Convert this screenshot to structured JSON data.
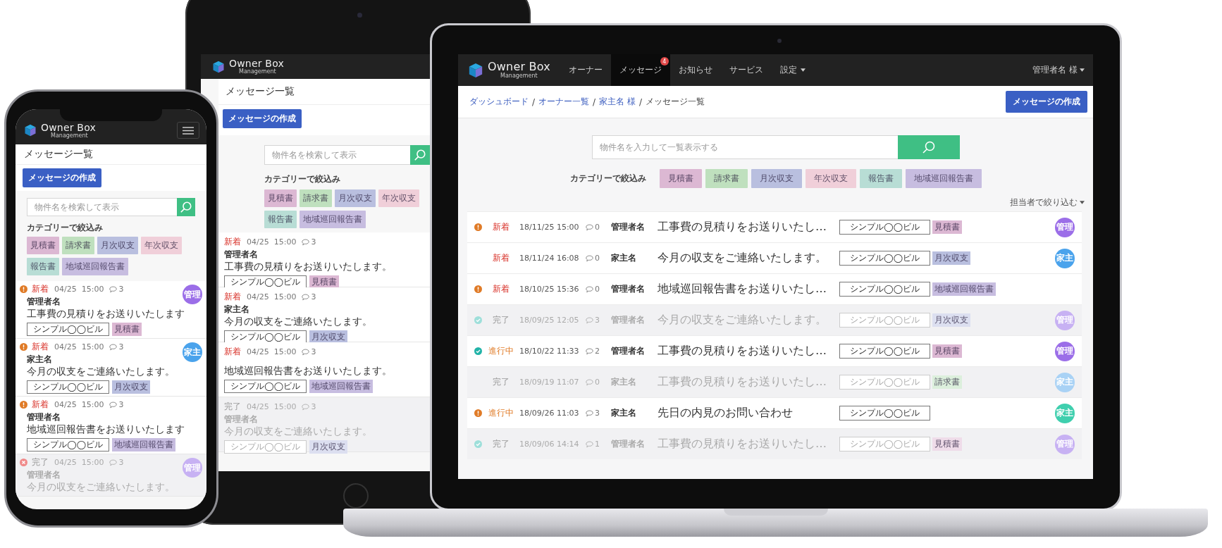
{
  "phone": {
    "brand": "Owner Box",
    "brand_sub": "Management",
    "title": "メッセージ一覧",
    "create_button": "メッセージの作成",
    "search_placeholder": "物件名を検索して表示",
    "filter_label": "カテゴリーで絞込み",
    "categories": [
      {
        "label": "見積書",
        "color": "#dcb8d3"
      },
      {
        "label": "請求書",
        "color": "#bfe0be"
      },
      {
        "label": "月次収支",
        "color": "#b9bfdf"
      },
      {
        "label": "年次収支",
        "color": "#f0cfd9"
      },
      {
        "label": "報告書",
        "color": "#b8ddd5"
      },
      {
        "label": "地域巡回報告書",
        "color": "#c7bde0"
      }
    ],
    "messages": [
      {
        "alert": true,
        "cancelled": false,
        "status": "新着",
        "kind": "new",
        "date": "04/25  15:00",
        "comments": "3",
        "sender": "管理者名",
        "subject": "工事費の見積りをお送りいたします",
        "building": "シンプル◯◯ビル",
        "tag": {
          "label": "見積書",
          "color": "#dcb8d3"
        },
        "avatar": {
          "label": "管理",
          "color": "#9b6ee8"
        }
      },
      {
        "alert": true,
        "cancelled": false,
        "status": "新着",
        "kind": "new",
        "date": "04/25  15:00",
        "comments": "3",
        "sender": "家主名",
        "subject": "今月の収支をご連絡いたします。",
        "building": "シンプル◯◯ビル",
        "tag": {
          "label": "月次収支",
          "color": "#b9bfdf"
        },
        "avatar": {
          "label": "家主",
          "color": "#4aa3ec"
        }
      },
      {
        "alert": true,
        "cancelled": false,
        "status": "新着",
        "kind": "new",
        "date": "04/25  15:00",
        "comments": "3",
        "sender": "管理者名",
        "subject": "地域巡回報告書をお送りいたします",
        "building": "シンプル◯◯ビル",
        "tag": {
          "label": "地域巡回報告書",
          "color": "#c7bde0"
        }
      },
      {
        "alert": false,
        "cancelled": true,
        "status": "完了",
        "kind": "done",
        "date": "04/25  15:00",
        "comments": "3",
        "sender": "管理者名",
        "subject": "今月の収支をご連絡いたします。",
        "avatar": {
          "label": "管理",
          "color": "#c7b1f3"
        }
      }
    ]
  },
  "tablet": {
    "brand": "Owner Box",
    "brand_sub": "Management",
    "title": "メッセージ一覧",
    "create_button": "メッセージの作成",
    "search_placeholder": "物件名を検索して表示",
    "filter_label": "カテゴリーで絞込み",
    "categories": [
      {
        "label": "見積書",
        "color": "#dcb8d3"
      },
      {
        "label": "請求書",
        "color": "#bfe0be"
      },
      {
        "label": "月次収支",
        "color": "#b9bfdf"
      },
      {
        "label": "年次収支",
        "color": "#f0cfd9"
      },
      {
        "label": "報告書",
        "color": "#b8ddd5"
      },
      {
        "label": "地域巡回報告書",
        "color": "#c7bde0"
      }
    ],
    "messages": [
      {
        "status": "新着",
        "kind": "new",
        "date": "04/25  15:00",
        "comments": "3",
        "sender": "管理者名",
        "subject": "工事費の見積りをお送りいたします。",
        "building": "シンプル◯◯ビル",
        "tag": {
          "label": "見積書",
          "color": "#dcb8d3"
        }
      },
      {
        "status": "新着",
        "kind": "new",
        "date": "04/25  15:00",
        "comments": "3",
        "sender": "家主名",
        "subject": "今月の収支をご連絡いたします。",
        "building": "シンプル◯◯ビル",
        "tag": {
          "label": "月次収支",
          "color": "#b9bfdf"
        }
      },
      {
        "status": "新着",
        "kind": "new",
        "date": "04/25  15:00",
        "comments": "3",
        "subject": "地域巡回報告書をお送りいたします。",
        "building": "シンプル◯◯ビル",
        "tag": {
          "label": "地域巡回報告書",
          "color": "#c7bde0"
        }
      },
      {
        "status": "完了",
        "kind": "done",
        "date": "04/25  15:00",
        "comments": "3",
        "sender": "管理者名",
        "subject": "今月の収支をご連絡いたします。",
        "building": "シンプル◯◯ビル",
        "tag": {
          "label": "月次収支",
          "color": "#dcdff0"
        }
      }
    ]
  },
  "laptop": {
    "brand": "Owner Box",
    "brand_sub": "Management",
    "nav": [
      {
        "label": "オーナー",
        "selected": false
      },
      {
        "label": "メッセージ",
        "selected": true,
        "badge": "4"
      },
      {
        "label": "お知らせ",
        "selected": false
      },
      {
        "label": "サービス",
        "selected": false
      },
      {
        "label": "設定",
        "selected": false,
        "has_menu": true
      }
    ],
    "user_menu": "管理者名 様",
    "breadcrumb": [
      {
        "label": "ダッシュボード",
        "link": true,
        "separator": "/"
      },
      {
        "label": "オーナー一覧",
        "link": true,
        "separator": "/"
      },
      {
        "label": "家主名 様",
        "link": true,
        "separator": "/"
      },
      {
        "label": "メッセージ一覧",
        "link": false
      }
    ],
    "create_button": "メッセージの作成",
    "search_placeholder": "物件名を入力して一覧表示する",
    "filter_label": "カテゴリーで絞込み",
    "categories": [
      {
        "label": "見積書",
        "color": "#dcb8d3"
      },
      {
        "label": "請求書",
        "color": "#bfe0be"
      },
      {
        "label": "月次収支",
        "color": "#b9bfdf"
      },
      {
        "label": "年次収支",
        "color": "#f0cfd9"
      },
      {
        "label": "報告書",
        "color": "#b8ddd5"
      },
      {
        "label": "地域巡回報告書",
        "color": "#c7bde0"
      }
    ],
    "assignee_filter": "担当者で絞り込む",
    "messages": [
      {
        "alert": true,
        "checked": false,
        "status": "新着",
        "kind": "new",
        "date": "18/11/25 15:00",
        "comments": "0",
        "sender": "管理者名",
        "subject": "工事費の見積りをお送りいたし…",
        "building": "シンプル◯◯ビル",
        "tag": {
          "label": "見積書",
          "color": "#dcb8d3"
        },
        "avatar": {
          "label": "管理",
          "color": "#9b6ee8"
        }
      },
      {
        "alert": false,
        "checked": false,
        "status": "新着",
        "kind": "new",
        "date": "18/11/24 16:08",
        "comments": "0",
        "sender": "家主名",
        "subject": "今月の収支をご連絡いたします。",
        "building": "シンプル◯◯ビル",
        "tag": {
          "label": "月次収支",
          "color": "#b9bfdf"
        },
        "avatar": {
          "label": "家主",
          "color": "#4aa3ec"
        }
      },
      {
        "alert": true,
        "checked": false,
        "status": "新着",
        "kind": "new",
        "date": "18/10/25 15:36",
        "comments": "0",
        "sender": "管理者名",
        "subject": "地域巡回報告書をお送りいたし…",
        "building": "シンプル◯◯ビル",
        "tag": {
          "label": "地域巡回報告書",
          "color": "#c7bde0"
        }
      },
      {
        "alert": false,
        "checked": true,
        "status": "完了",
        "kind": "done",
        "date": "18/09/25 12:05",
        "comments": "3",
        "sender": "管理者名",
        "subject": "今月の収支をご連絡いたします。",
        "building": "シンプル◯◯ビル",
        "tag": {
          "label": "月次収支",
          "color": "#dcdff0"
        },
        "avatar": {
          "label": "管理",
          "color": "#c7b1f3"
        }
      },
      {
        "alert": false,
        "checked": true,
        "status": "進行中",
        "kind": "progress",
        "date": "18/10/22 11:33",
        "comments": "2",
        "sender": "管理者名",
        "subject": "工事費の見積りをお送りいたし…",
        "building": "シンプル◯◯ビル",
        "tag": {
          "label": "見積書",
          "color": "#dcb8d3"
        },
        "avatar": {
          "label": "管理",
          "color": "#9b6ee8"
        }
      },
      {
        "alert": false,
        "checked": false,
        "status": "完了",
        "kind": "done",
        "date": "18/09/19 11:07",
        "comments": "0",
        "sender": "家主名",
        "subject": "工事費の見積りをお送りいたし…",
        "building": "シンプル◯◯ビル",
        "tag": {
          "label": "請求書",
          "color": "#dcefdc"
        },
        "avatar": {
          "label": "家主",
          "color": "#a9d2f5"
        }
      },
      {
        "alert": true,
        "checked": false,
        "status": "進行中",
        "kind": "progress",
        "date": "18/09/26 11:03",
        "comments": "3",
        "sender": "家主名",
        "subject": "先日の内見のお問い合わせ",
        "building": "シンプル◯◯ビル",
        "avatar": {
          "label": "家主",
          "color": "#3fcfae"
        }
      },
      {
        "alert": false,
        "checked": true,
        "status": "完了",
        "kind": "done",
        "date": "18/09/06 14:14",
        "comments": "1",
        "sender": "管理者名",
        "subject": "工事費の見積りをお送りいたし…",
        "building": "シンプル◯◯ビル",
        "tag": {
          "label": "見積書",
          "color": "#efdce9"
        },
        "avatar": {
          "label": "管理",
          "color": "#c7b1f3"
        }
      }
    ]
  }
}
